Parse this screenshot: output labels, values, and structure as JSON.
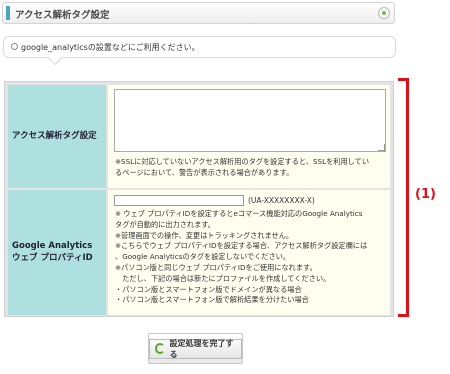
{
  "header": {
    "title": "アクセス解析タグ設定"
  },
  "info": {
    "text": "google_analyticsの設置などにご利用ください。"
  },
  "rows": [
    {
      "label": "アクセス解析タグ設定",
      "note_lines": [
        "※SSLに対応していないアクセス解析用のタグを設定すると、SSLを利用してい",
        "るページにおいて、警告が表示される場合があります。"
      ]
    },
    {
      "label_lines": [
        "Google Analytics",
        "ウェブ プロパティID"
      ],
      "input_value": "",
      "input_hint": "(UA-XXXXXXXX-X)",
      "note_lines": [
        "※ ウェブ プロパティIDを設定するとeコマース機能対応のGoogle Analytics",
        "タグが自動的に出力されます。",
        "※管理画面での操作、変更はトラッキングされません。",
        "※こちらでウェブ プロパティIDを設定する場合、アクセス解析タグ設定欄には",
        "、Google Analyticsのタグを設定しないでください。",
        "※パソコン版と同じウェブ プロパティIDをご使用になれます。",
        "　ただし、下記の場合は新たにプロファイルを作成してください。",
        "・パソコン版とスマートフォン版でドメインが異なる場合",
        "・パソコン版とスマートフォン版で解析結果を分けたい場合"
      ]
    }
  ],
  "annotation": {
    "label": "(1)",
    "color": "#e0101a"
  },
  "submit": {
    "label": "設定処理を完了する"
  },
  "colors": {
    "label_bg": "#aee0e0",
    "value_bg": "#fffff0",
    "accent": "#4aa9b6"
  }
}
